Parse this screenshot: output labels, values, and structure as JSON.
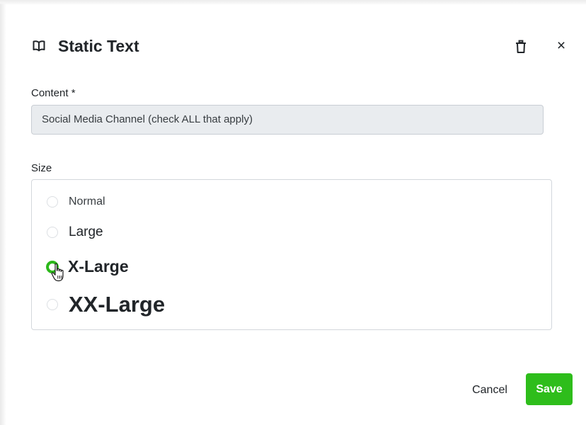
{
  "dialog": {
    "title": "Static Text",
    "title_icon": "book-open-icon",
    "delete_icon": "trash-icon",
    "close_label": "×"
  },
  "content_field": {
    "label": "Content *",
    "value": "Social Media Channel (check ALL that apply)"
  },
  "size_field": {
    "label": "Size",
    "selected": "X-Large",
    "options": [
      {
        "label": "Normal",
        "checked": false
      },
      {
        "label": "Large",
        "checked": false
      },
      {
        "label": "X-Large",
        "checked": true
      },
      {
        "label": "XX-Large",
        "checked": false
      }
    ]
  },
  "footer": {
    "cancel_label": "Cancel",
    "save_label": "Save"
  },
  "colors": {
    "accent": "#2ebd1b",
    "input_background": "#e9ecef",
    "text": "#212529"
  }
}
